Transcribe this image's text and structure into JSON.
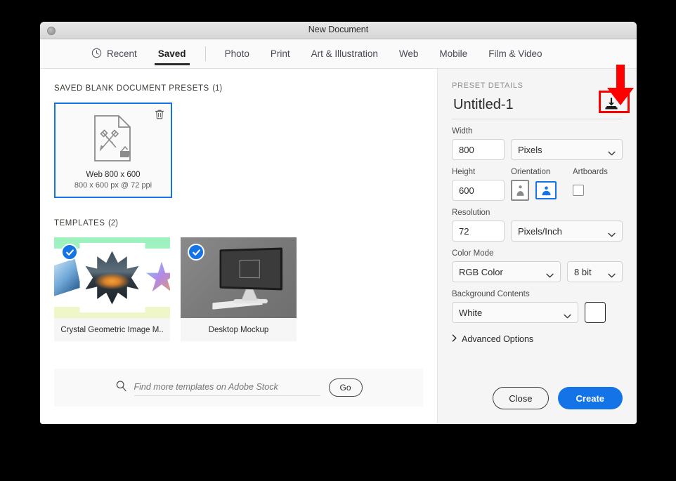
{
  "window": {
    "title": "New Document",
    "close_dot": "window-close-dot"
  },
  "tabs": [
    {
      "id": "recent",
      "label": "Recent",
      "icon": "clock-icon",
      "active": false
    },
    {
      "id": "saved",
      "label": "Saved",
      "icon": null,
      "active": true
    },
    {
      "id": "photo",
      "label": "Photo",
      "icon": null,
      "active": false
    },
    {
      "id": "print",
      "label": "Print",
      "icon": null,
      "active": false
    },
    {
      "id": "art",
      "label": "Art & Illustration",
      "icon": null,
      "active": false
    },
    {
      "id": "web",
      "label": "Web",
      "icon": null,
      "active": false
    },
    {
      "id": "mobile",
      "label": "Mobile",
      "icon": null,
      "active": false
    },
    {
      "id": "film",
      "label": "Film & Video",
      "icon": null,
      "active": false
    }
  ],
  "left_panel": {
    "presets_heading": "SAVED BLANK DOCUMENT PRESETS",
    "presets_count": "(1)",
    "presets": [
      {
        "name": "Web 800 x 600",
        "details": "800 x 600 px @ 72 ppi",
        "selected": true,
        "delete_icon": "trash-icon",
        "thumb_icon": "document-preset-icon"
      }
    ],
    "templates_heading": "TEMPLATES",
    "templates_count": "(2)",
    "templates": [
      {
        "name": "Crystal Geometric Image M..",
        "checked": true,
        "thumb": "crystal-geometric-thumbnail"
      },
      {
        "name": "Desktop Mockup",
        "checked": true,
        "thumb": "desktop-mockup-thumbnail"
      }
    ],
    "stock": {
      "search_icon": "search-icon",
      "placeholder": "Find more templates on Adobe Stock",
      "value": "",
      "go_label": "Go"
    }
  },
  "right_panel": {
    "heading": "PRESET DETAILS",
    "document_name": "Untitled-1",
    "save_preset_icon": "save-preset-icon",
    "fields": {
      "width_label": "Width",
      "width_value": "800",
      "width_unit": "Pixels",
      "height_label": "Height",
      "height_value": "600",
      "orientation_label": "Orientation",
      "orientation_portrait": "portrait-orientation-icon",
      "orientation_landscape": "landscape-orientation-icon",
      "orientation_selected": "landscape",
      "artboards_label": "Artboards",
      "artboards_checked": false,
      "resolution_label": "Resolution",
      "resolution_value": "72",
      "resolution_unit": "Pixels/Inch",
      "color_mode_label": "Color Mode",
      "color_mode_value": "RGB Color",
      "bit_depth_value": "8 bit",
      "background_label": "Background Contents",
      "background_value": "White",
      "background_swatch": "#ffffff"
    },
    "advanced_options_label": "Advanced Options",
    "advanced_chevron": "chevron-right-icon",
    "close_label": "Close",
    "create_label": "Create"
  },
  "annotation": {
    "arrow_color": "#ff0000",
    "highlight_color": "#ff0000",
    "target": "save-preset-button"
  },
  "colors": {
    "accent": "#1473e6",
    "panel_bg": "#f5f5f5",
    "dialog_bg": "#ffffff",
    "backdrop": "#000000"
  }
}
